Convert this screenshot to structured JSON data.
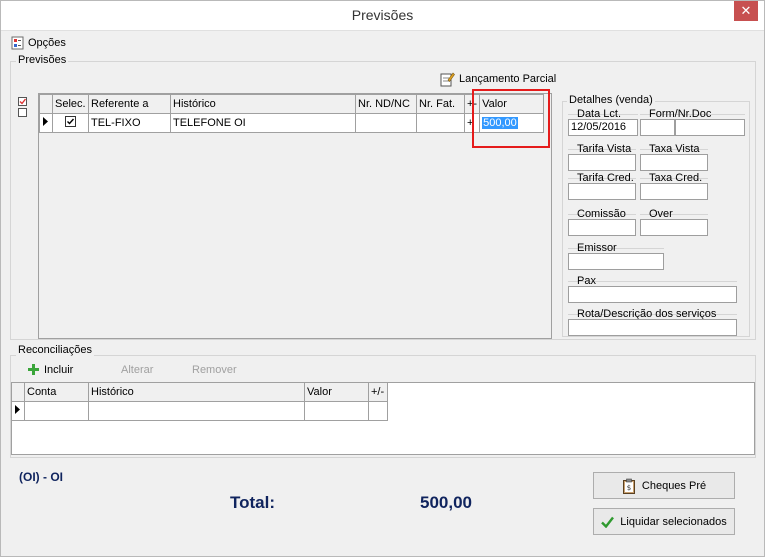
{
  "window": {
    "title": "Previsões",
    "close_glyph": "✕"
  },
  "menu": {
    "opcoes_label": "Opções"
  },
  "previsoes": {
    "label": "Previsões",
    "lancamento_parcial_label": "Lançamento Parcial",
    "columns": [
      "Selec.",
      "Referente a",
      "Histórico",
      "Nr. ND/NC",
      "Nr. Fat.",
      "+-",
      "Valor"
    ],
    "row": {
      "referente_a": "TEL-FIXO",
      "historico": "TELEFONE OI",
      "nr_nd_nc": "",
      "nr_fat": "",
      "sinal": "+",
      "valor": "500,00"
    }
  },
  "detalhes": {
    "label": "Detalhes (venda)",
    "data_lct_label": "Data Lct.",
    "data_lct_value": "12/05/2016",
    "form_nr_doc_label": "Form/Nr.Doc",
    "tarifa_vista_label": "Tarifa Vista",
    "taxa_vista_label": "Taxa Vista",
    "tarifa_cred_label": "Tarifa Cred.",
    "taxa_cred_label": "Taxa Cred.",
    "comissao_label": "Comissão",
    "over_label": "Over",
    "emissor_label": "Emissor",
    "pax_label": "Pax",
    "rota_label": "Rota/Descrição dos serviços"
  },
  "reconciliacoes": {
    "label": "Reconciliações",
    "incluir_label": "Incluir",
    "alterar_label": "Alterar",
    "remover_label": "Remover",
    "columns": [
      "Conta",
      "Histórico",
      "Valor",
      "+/-"
    ]
  },
  "footer": {
    "account_label": "(OI) - OI",
    "total_label": "Total:",
    "total_value": "500,00",
    "cheques_pre_label": "Cheques Pré",
    "liquidar_label": "Liquidar selecionados"
  },
  "colors": {
    "highlight": "#e51b1b",
    "selection": "#3399ff",
    "total_text": "#10245e"
  }
}
